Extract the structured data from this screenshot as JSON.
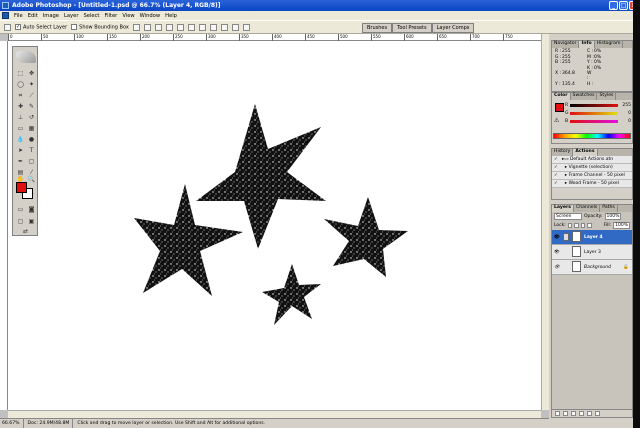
{
  "window": {
    "title": "Adobe Photoshop - [Untitled-1.psd @ 66.7% (Layer 4, RGB/8)]"
  },
  "menu": [
    "File",
    "Edit",
    "Image",
    "Layer",
    "Select",
    "Filter",
    "View",
    "Window",
    "Help"
  ],
  "options_bar": {
    "auto_select_label": "Auto Select Layer",
    "bounding_box_label": "Show Bounding Box",
    "wells": [
      "Brushes",
      "Tool Presets",
      "Layer Comps"
    ]
  },
  "ruler": {
    "ticks": [
      "0",
      "50",
      "100",
      "150",
      "200",
      "250",
      "300",
      "350",
      "400",
      "450",
      "500",
      "550",
      "600",
      "650",
      "700",
      "750"
    ]
  },
  "status": {
    "zoom": "66.67%",
    "doc": "Doc: 24.9M/48.8M",
    "hint": "Click and drag to move layer or selection.  Use Shift and Alt for additional options."
  },
  "info_panel": {
    "tabs": [
      "Navigator",
      "Info",
      "Histogram"
    ],
    "active": "Info",
    "rows": [
      [
        "R :",
        "255",
        "C :",
        "0%"
      ],
      [
        "G :",
        "255",
        "M :",
        "0%"
      ],
      [
        "B :",
        "255",
        "Y :",
        "0%"
      ],
      [
        "",
        "",
        "K :",
        "0%"
      ],
      [
        "X :",
        "364.8",
        "W :",
        ""
      ],
      [
        "Y :",
        "135.4",
        "H :",
        ""
      ]
    ]
  },
  "color_panel": {
    "tabs": [
      "Color",
      "Swatches",
      "Styles"
    ],
    "active": "Color",
    "channels": [
      {
        "label": "R",
        "value": "255",
        "color": "#e01010"
      },
      {
        "label": "G",
        "value": "0",
        "color": "#b0a000"
      },
      {
        "label": "B",
        "value": "0",
        "color": "#c000c0"
      }
    ]
  },
  "actions_panel": {
    "tabs": [
      "History",
      "Actions"
    ],
    "active": "Actions",
    "rows": [
      "Default Actions.atn",
      "Vignette (selection)",
      "Frame Channel - 50 pixel",
      "Wood Frame - 50 pixel"
    ]
  },
  "layers_panel": {
    "tabs": [
      "Layers",
      "Channels",
      "Paths"
    ],
    "active": "Layers",
    "blend_mode": "Screen",
    "opacity_label": "Opacity:",
    "opacity": "100%",
    "lock_label": "Lock:",
    "fill_label": "Fill:",
    "fill": "100%",
    "layers": [
      "Layer 4",
      "Layer 3",
      "Background"
    ]
  },
  "colors": {
    "accent": "#316ac5",
    "foreground": "#e01010",
    "title": "#0a46c4"
  }
}
